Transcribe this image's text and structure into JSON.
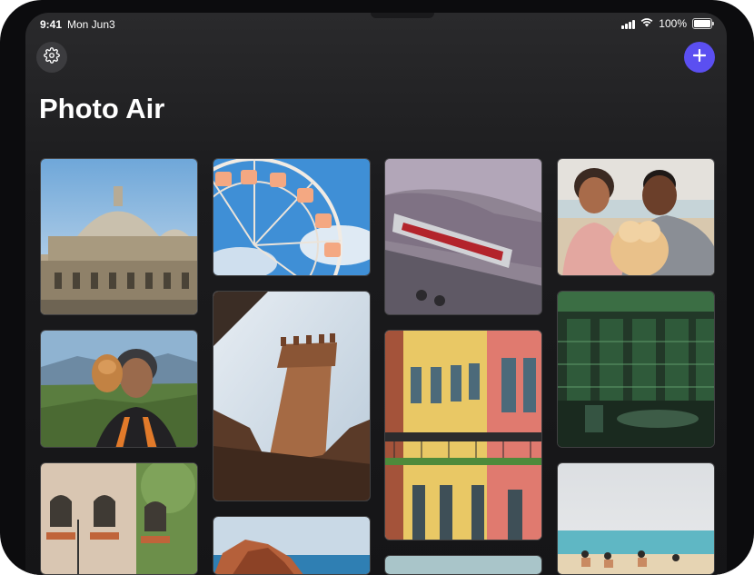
{
  "status_bar": {
    "time": "9:41",
    "date": "Mon Jun3",
    "battery_pct_label": "100%",
    "battery_level": 1.0
  },
  "header": {
    "title": "Photo Air"
  },
  "icons": {
    "settings": "gear-icon",
    "add": "plus-icon",
    "wifi": "wifi-icon",
    "signal": "cellular-signal-icon",
    "battery": "battery-icon"
  },
  "colors": {
    "accent": "#5b4ff1",
    "background": "#1b1b1d",
    "settings_button": "#3c3c3f"
  },
  "photos": [
    {
      "subject": "domed baroque building"
    },
    {
      "subject": "ferris wheel against blue sky"
    },
    {
      "subject": "vintage car tail light"
    },
    {
      "subject": "couple with golden retriever on beach"
    },
    {
      "subject": "woman with dog in mountains"
    },
    {
      "subject": "medieval brick tower"
    },
    {
      "subject": "colorful colonial buildings with balconies"
    },
    {
      "subject": "green-lit interior"
    },
    {
      "subject": "building facade with window boxes"
    },
    {
      "subject": "rocky coastline"
    },
    {
      "subject": "pale teal"
    },
    {
      "subject": "sunny beach with people"
    }
  ]
}
